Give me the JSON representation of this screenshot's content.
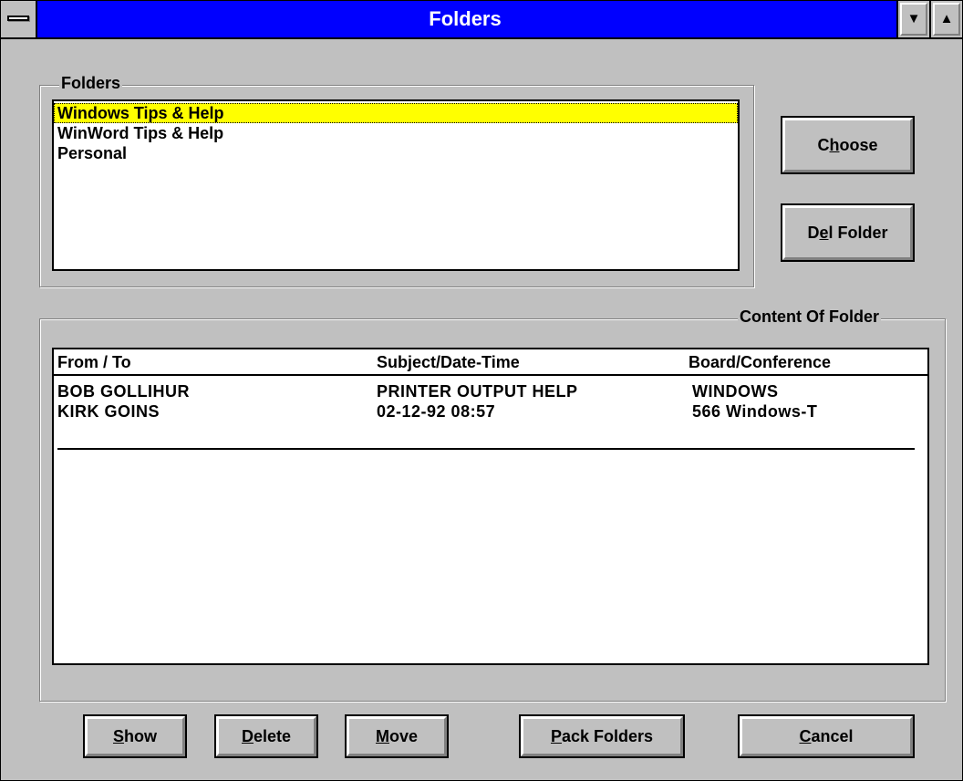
{
  "window": {
    "title": "Folders",
    "minimize_glyph": "▼",
    "maximize_glyph": "▲"
  },
  "folders_group": {
    "label": "Folders",
    "items": [
      {
        "label": "Windows Tips & Help",
        "selected": true
      },
      {
        "label": "WinWord Tips & Help",
        "selected": false
      },
      {
        "label": "Personal",
        "selected": false
      }
    ]
  },
  "side_buttons": {
    "choose": {
      "pre": "C",
      "accel": "h",
      "post": "oose"
    },
    "del_folder": {
      "pre": "D",
      "accel": "e",
      "post": "l Folder"
    }
  },
  "content_group": {
    "label": "Content Of Folder",
    "columns": [
      "From / To",
      "Subject/Date-Time",
      "Board/Conference"
    ],
    "rows": [
      {
        "from": "BOB GOLLIHUR",
        "subject": "PRINTER OUTPUT HELP",
        "board": "WINDOWS"
      },
      {
        "from": "KIRK GOINS",
        "subject": "02-12-92 08:57",
        "board": "566 Windows-T"
      }
    ]
  },
  "bottom_buttons": {
    "show": {
      "pre": "",
      "accel": "S",
      "post": "how"
    },
    "delete": {
      "pre": "",
      "accel": "D",
      "post": "elete"
    },
    "move": {
      "pre": "",
      "accel": "M",
      "post": "ove"
    },
    "pack": {
      "pre": "",
      "accel": "P",
      "post": "ack Folders"
    },
    "cancel": {
      "pre": "",
      "accel": "C",
      "post": "ancel"
    }
  },
  "colors": {
    "titlebar": "#0000ff",
    "selection": "#ffff00",
    "face": "#c0c0c0"
  }
}
